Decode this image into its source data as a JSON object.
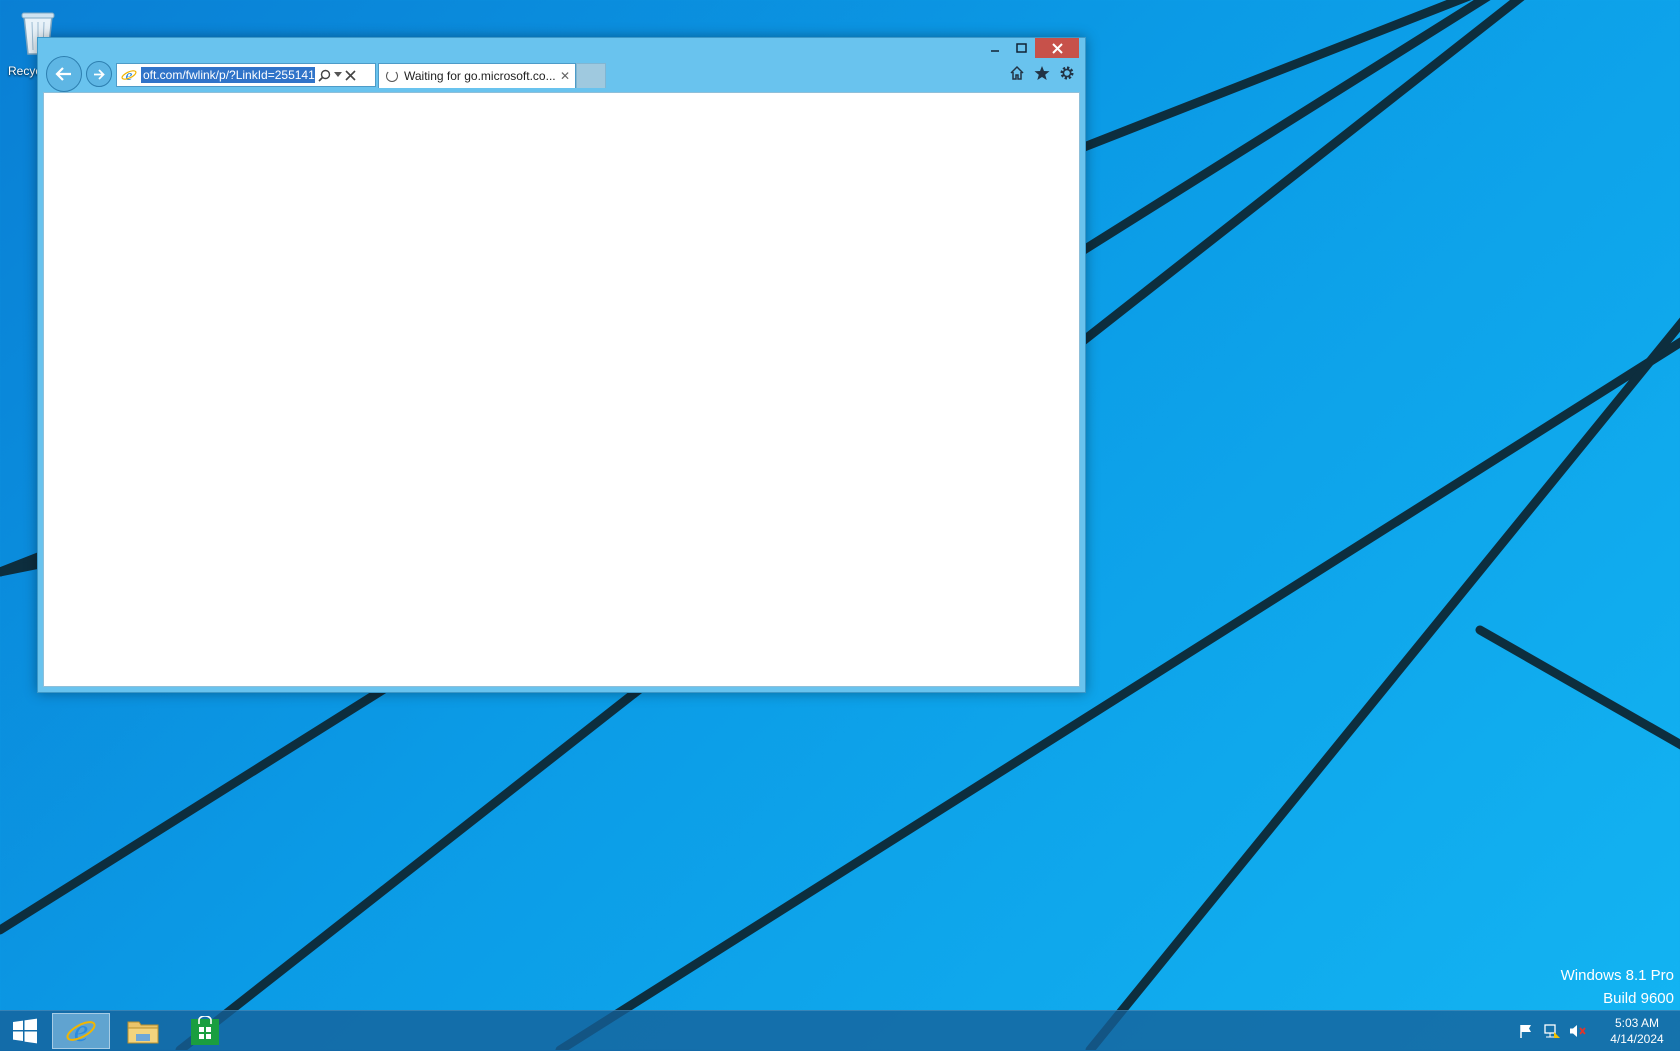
{
  "desktop": {
    "recycle_bin_label": "Recyc",
    "watermark": {
      "line1": "Windows 8.1 Pro",
      "line2": "Build 9600"
    }
  },
  "browser": {
    "address": "oft.com/fwlink/p/?LinkId=255141",
    "tab": {
      "title": "Waiting for go.microsoft.co...",
      "close_glyph": "✕"
    },
    "icons": {
      "back": "back-arrow-icon",
      "forward": "forward-arrow-icon",
      "favicon": "ie-logo-icon",
      "search": "search-icon",
      "dropdown": "chevron-down-icon",
      "stop": "stop-icon",
      "home": "home-icon",
      "favorites": "star-icon",
      "tools": "gear-icon"
    }
  },
  "taskbar": {
    "items": [
      "start-button",
      "internet-explorer",
      "file-explorer",
      "store"
    ],
    "clock": {
      "time": "5:03 AM",
      "date": "4/14/2024"
    },
    "tray": [
      "flag-icon",
      "network-icon",
      "volume-muted-icon"
    ]
  },
  "colors": {
    "accent": "#0b9be6",
    "window_chrome": "#69c3ee",
    "close": "#c7514a",
    "selection": "#3074c9"
  }
}
